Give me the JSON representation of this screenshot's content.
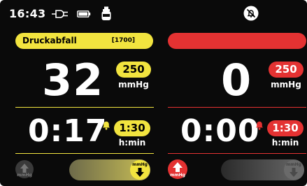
{
  "status_bar": {
    "time": "16:43",
    "icons": [
      "plug-icon",
      "battery-icon",
      "bottle-icon"
    ],
    "alarm_muted_icon": "bell-muted-icon"
  },
  "left_channel": {
    "alarm_label": "Druckabfall",
    "alarm_code": "[1700]",
    "pressure_value": "32",
    "pressure_setpoint": "250",
    "pressure_unit": "mmHg",
    "timer_value": "0:17",
    "timer_setpoint": "1:30",
    "timer_unit": "h:min",
    "deflate_button_unit": "mmHg",
    "inflate_knob_unit": "mmHg",
    "accent_color": "#f2e43f"
  },
  "right_channel": {
    "alarm_label": "",
    "pressure_value": "0",
    "pressure_setpoint": "250",
    "pressure_unit": "mmHg",
    "timer_value": "0:00",
    "timer_setpoint": "1:30",
    "timer_unit": "h:min",
    "inflate_button_unit": "mmHg",
    "deflate_knob_unit": "mmHg",
    "accent_color": "#e43232"
  }
}
